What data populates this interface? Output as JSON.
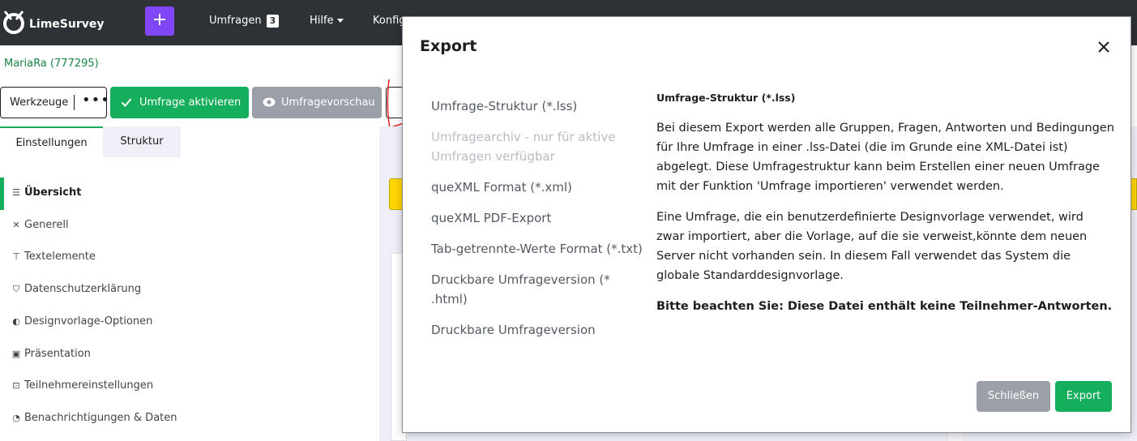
{
  "navbar": {
    "brand": "LimeSurvey",
    "plus_label": "+",
    "surveys_label": "Umfragen",
    "surveys_count": "3",
    "help_label": "Hilfe",
    "config_label": "Konfig"
  },
  "survey": {
    "title": "MariaRa (777295)"
  },
  "toolbar": {
    "tools_label": "Werkzeuge",
    "activate_label": "Umfrage aktivieren",
    "preview_label": "Umfragevorschau"
  },
  "tabs": {
    "settings": "Einstellungen",
    "structure": "Struktur"
  },
  "sidebar": {
    "items": [
      {
        "label": "Übersicht",
        "icon": "list-icon"
      },
      {
        "label": "Generell",
        "icon": "tools-icon"
      },
      {
        "label": "Textelemente",
        "icon": "text-icon"
      },
      {
        "label": "Datenschutzerklärung",
        "icon": "shield-icon"
      },
      {
        "label": "Designvorlage-Optionen",
        "icon": "contrast-icon"
      },
      {
        "label": "Präsentation",
        "icon": "presentation-icon"
      },
      {
        "label": "Teilnehmereinstellungen",
        "icon": "participants-icon"
      },
      {
        "label": "Benachrichtigungen & Daten",
        "icon": "bell-icon"
      }
    ]
  },
  "modal": {
    "title": "Export",
    "formats": [
      {
        "label": "Umfrage-Struktur (*.lss)",
        "disabled": false
      },
      {
        "label": "Umfragearchiv - nur für aktive Umfragen verfügbar",
        "disabled": true
      },
      {
        "label": "queXML Format (*.xml)",
        "disabled": false
      },
      {
        "label": "queXML PDF-Export",
        "disabled": false
      },
      {
        "label": "Tab-getrennte-Werte Format (*.txt)",
        "disabled": false
      },
      {
        "label": "Druckbare Umfrageversion (* .html)",
        "disabled": false
      },
      {
        "label": "Druckbare Umfrageversion",
        "disabled": false
      }
    ],
    "description": {
      "title": "Umfrage-Struktur (*.lss)",
      "p1": "Bei diesem Export werden alle Gruppen, Fragen, Antworten und Bedingungen für Ihre Umfrage in einer .lss-Datei (die im Grunde eine XML-Datei ist) abgelegt. Diese Umfragestruktur kann beim Erstellen einer neuen Umfrage mit der Funktion 'Umfrage importieren' verwendet werden.",
      "p2": "Eine Umfrage, die ein benutzerdefinierte Designvorlage verwendet, wird zwar importiert, aber die Vorlage, auf die sie verweist,könnte dem neuen Server nicht vorhanden sein. In diesem Fall verwendet das System die globale Standarddesignvorlage.",
      "p3": "Bitte beachten Sie: Diese Datei enthält keine Teilnehmer-Antworten."
    },
    "close_label": "Schließen",
    "export_label": "Export"
  },
  "colors": {
    "navbar": "#2e3135",
    "accent_green": "#14ae5c",
    "accent_purple": "#8146f6",
    "grey_button": "#9ba0a8",
    "warning": "#ffd600"
  }
}
